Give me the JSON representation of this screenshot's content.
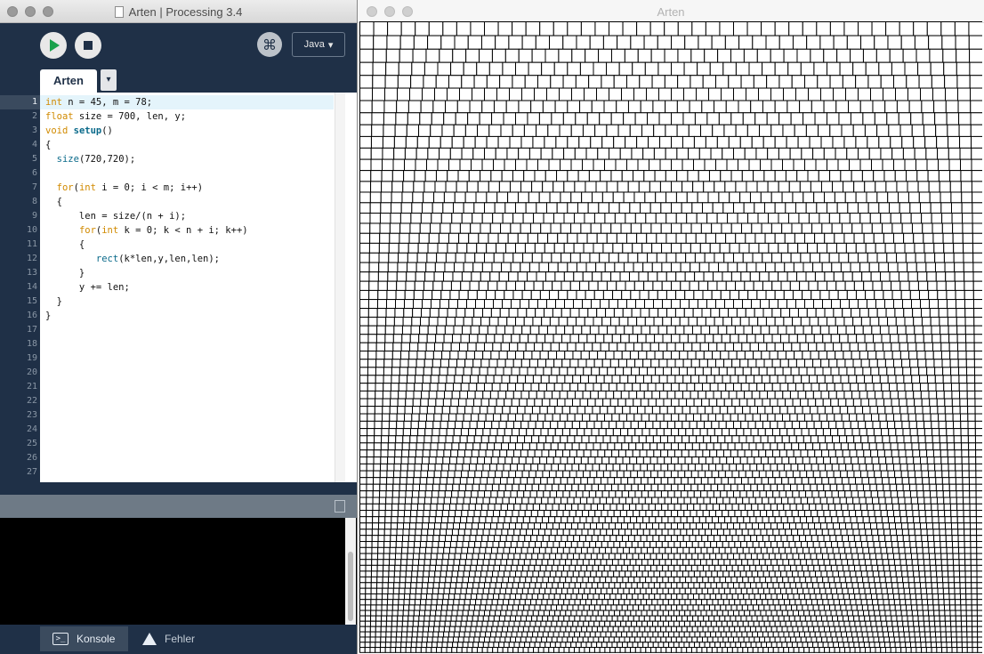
{
  "ide_window": {
    "title": "Arten | Processing 3.4",
    "mode": "Java",
    "tab_name": "Arten",
    "tab_menu_glyph": "▾",
    "code_lines": [
      "int n = 45, m = 78;",
      "float size = 700, len, y;",
      "void setup()",
      "{",
      "  size(720,720);",
      "",
      "  for(int i = 0; i < m; i++)",
      "  {",
      "      len = size/(n + i);",
      "      for(int k = 0; k < n + i; k++)",
      "      {",
      "         rect(k*len,y,len,len);",
      "      }",
      "      y += len;",
      "  }",
      "}",
      "",
      "",
      "",
      "",
      "",
      "",
      "",
      "",
      "",
      "",
      ""
    ],
    "line_numbers": [
      "1",
      "2",
      "3",
      "4",
      "5",
      "6",
      "7",
      "8",
      "9",
      "10",
      "11",
      "12",
      "13",
      "14",
      "15",
      "16",
      "17",
      "18",
      "19",
      "20",
      "21",
      "22",
      "23",
      "24",
      "25",
      "26",
      "27"
    ],
    "current_line": 1,
    "bottom_tabs": {
      "console": "Konsole",
      "errors": "Fehler"
    },
    "icons": {
      "run": "play-icon",
      "stop": "stop-icon",
      "debug": "debugger-icon",
      "console_header": "clipboard-icon",
      "console_tab": "terminal-icon",
      "errors_tab": "warning-icon"
    },
    "colors": {
      "toolbar": "#1f3047",
      "run": "#1aa14b",
      "keyword": "#d18a00",
      "function": "#0a6a8a"
    }
  },
  "sketch_window": {
    "title": "Arten",
    "sketch": {
      "n": 45,
      "m": 78,
      "size": 700,
      "stroke": "#000000",
      "fill": "#ffffff"
    }
  }
}
